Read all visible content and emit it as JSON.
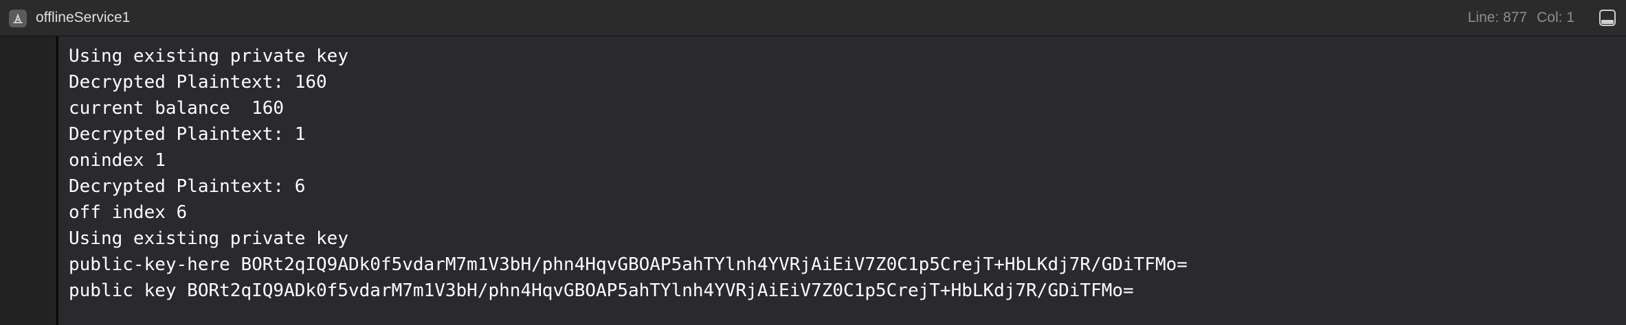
{
  "header": {
    "app_icon": "app-store-a-icon",
    "title": "offlineService1",
    "line_label": "Line: 877",
    "col_label": "Col: 1",
    "panel_toggle_icon": "bottom-panel-toggle-icon"
  },
  "console": {
    "lines": [
      "Using existing private key",
      "Decrypted Plaintext: 160",
      "current balance  160",
      "Decrypted Plaintext: 1",
      "onindex 1",
      "Decrypted Plaintext: 6",
      "off index 6",
      "Using existing private key",
      "public-key-here BORt2qIQ9ADk0f5vdarM7m1V3bH/phn4HqvGBOAP5ahTYlnh4YVRjAiEiV7Z0C1p5CrejT+HbLKdj7R/GDiTFMo=",
      "public key BORt2qIQ9ADk0f5vdarM7m1V3bH/phn4HqvGBOAP5ahTYlnh4YVRjAiEiV7Z0C1p5CrejT+HbLKdj7R/GDiTFMo="
    ]
  },
  "colors": {
    "header_bg": "#2b2b2b",
    "console_bg": "#2a2a2e",
    "gutter_bg": "#222222",
    "text": "#ffffff",
    "muted_text": "#8e8e8e"
  }
}
